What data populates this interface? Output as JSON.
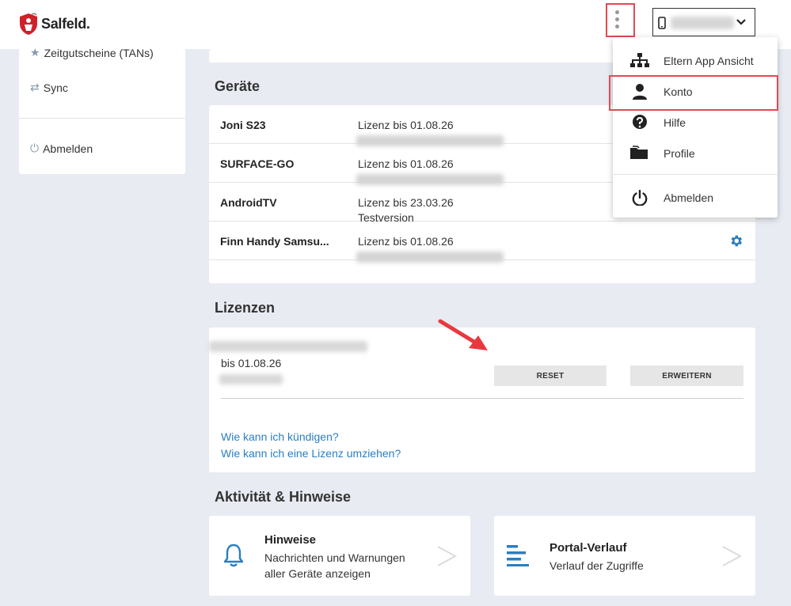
{
  "brand": {
    "name": "Salfeld."
  },
  "header": {
    "device_select": {
      "value": ""
    }
  },
  "sidebar": {
    "items": [
      {
        "label": "Zeitgutscheine (TANs)",
        "icon": "star-icon"
      },
      {
        "label": "Sync",
        "icon": "sync-icon"
      },
      {
        "label": "Abmelden",
        "icon": "power-icon"
      }
    ]
  },
  "devices": {
    "title": "Geräte",
    "rows": [
      {
        "name": "Joni S23",
        "license": "Lizenz bis 01.08.26",
        "sub": ""
      },
      {
        "name": "SURFACE-GO",
        "license": "Lizenz bis 01.08.26",
        "sub": ""
      },
      {
        "name": "AndroidTV",
        "license": "Lizenz bis 23.03.26",
        "sub": "Testversion"
      },
      {
        "name": "Finn Handy Samsu...",
        "license": "Lizenz bis 01.08.26",
        "sub": ""
      }
    ]
  },
  "licenses": {
    "title": "Lizenzen",
    "valid_until": "bis 01.08.26",
    "reset_label": "RESET",
    "extend_label": "ERWEITERN",
    "links": [
      "Wie kann ich kündigen?",
      "Wie kann ich eine Lizenz umziehen?"
    ]
  },
  "activity": {
    "title": "Aktivität & Hinweise",
    "tiles": [
      {
        "title": "Hinweise",
        "text_line1": "Nachrichten und Warnungen",
        "text_line2": "aller Geräte anzeigen",
        "icon": "bell-icon"
      },
      {
        "title": "Portal-Verlauf",
        "text_line1": "Verlauf der Zugriffe",
        "icon": "list-icon"
      }
    ]
  },
  "menu": {
    "items": [
      {
        "label": "Eltern App Ansicht",
        "icon": "sitemap-icon"
      },
      {
        "label": "Konto",
        "icon": "user-icon"
      },
      {
        "label": "Hilfe",
        "icon": "help-icon"
      },
      {
        "label": "Profile",
        "icon": "folder-icon"
      },
      {
        "label": "Abmelden",
        "icon": "power-icon"
      }
    ]
  },
  "colors": {
    "accent": "#2a7fc0",
    "highlight": "#e24a55",
    "background": "#e8ebf2"
  }
}
